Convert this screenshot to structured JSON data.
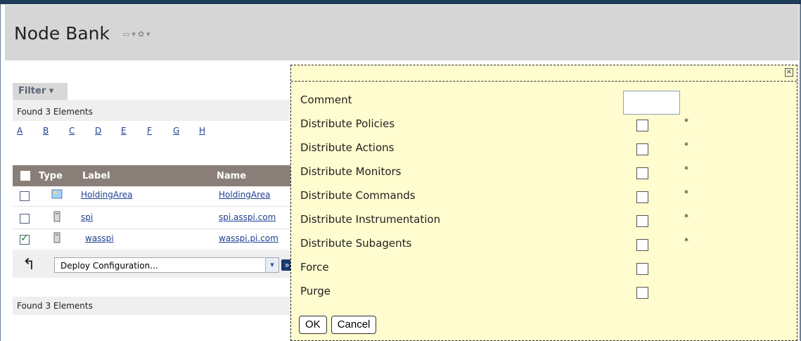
{
  "header": {
    "title": "Node Bank",
    "icons": [
      "view-icon",
      "dropdown-arrow-icon",
      "gear-icon",
      "dropdown-arrow-icon"
    ]
  },
  "filter": {
    "label": "Filter"
  },
  "summary": {
    "found_top": "Found 3 Elements",
    "found_bottom": "Found 3 Elements"
  },
  "alphabet": [
    "A",
    "B",
    "C",
    "D",
    "E",
    "F",
    "G",
    "H"
  ],
  "table": {
    "headers": {
      "type": "Type",
      "label": "Label",
      "name": "Name"
    },
    "rows": [
      {
        "checked": false,
        "label": "HoldingArea",
        "name": "HoldingArea",
        "icon": "holding-area-icon"
      },
      {
        "checked": false,
        "label": "spi",
        "name": "spi.asspi.com",
        "icon": "node-icon"
      },
      {
        "checked": true,
        "label": "wasspi",
        "name": "wasspi.pi.com",
        "icon": "node-icon"
      }
    ]
  },
  "footer": {
    "select_value": "Deploy Configuration..."
  },
  "dialog": {
    "close_symbol": "×",
    "fields": [
      {
        "label": "Comment",
        "type": "text",
        "value": ""
      },
      {
        "label": "Distribute Policies",
        "type": "checkbox",
        "checked": false,
        "required": "*"
      },
      {
        "label": "Distribute Actions",
        "type": "checkbox",
        "checked": false,
        "required": "*"
      },
      {
        "label": "Distribute Monitors",
        "type": "checkbox",
        "checked": false,
        "required": "*"
      },
      {
        "label": "Distribute Commands",
        "type": "checkbox",
        "checked": false,
        "required": "*"
      },
      {
        "label": "Distribute Instrumentation",
        "type": "checkbox",
        "checked": false,
        "required": "*"
      },
      {
        "label": "Distribute Subagents",
        "type": "checkbox",
        "checked": false,
        "required": "*"
      },
      {
        "label": "Force",
        "type": "checkbox",
        "checked": false
      },
      {
        "label": "Purge",
        "type": "checkbox",
        "checked": false
      }
    ],
    "buttons": {
      "ok": "OK",
      "cancel": "Cancel"
    }
  }
}
